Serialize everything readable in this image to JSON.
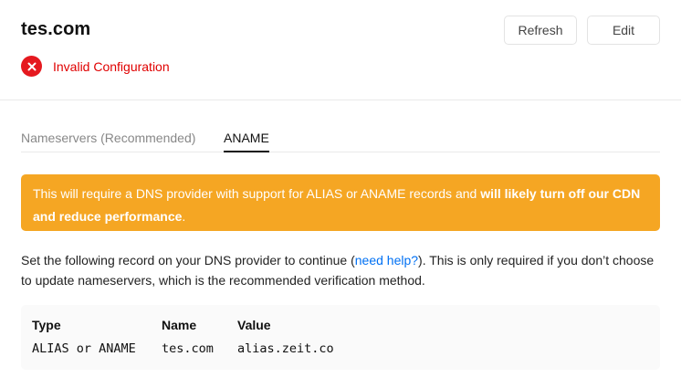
{
  "header": {
    "domain": "tes.com",
    "status_text": "Invalid Configuration",
    "status_icon": "error-x-icon",
    "status_color": "#e5191f",
    "refresh_label": "Refresh",
    "edit_label": "Edit"
  },
  "tabs": [
    {
      "label": "Nameservers (Recommended)",
      "active": false
    },
    {
      "label": "ANAME",
      "active": true
    }
  ],
  "warning": {
    "text_plain": "This will require a DNS provider with support for ALIAS or ANAME records and ",
    "text_bold": "will likely turn off our CDN and reduce performance",
    "text_end": ".",
    "color": "#f5a623"
  },
  "instructions": {
    "before_link": "Set the following record on your DNS provider to continue (",
    "link": "need help?",
    "after_link": "). This is only required if you don’t choose to update nameservers, which is the recommended verification method."
  },
  "record": {
    "headers": [
      "Type",
      "Name",
      "Value"
    ],
    "values": [
      "ALIAS or ANAME",
      "tes.com",
      "alias.zeit.co"
    ]
  }
}
